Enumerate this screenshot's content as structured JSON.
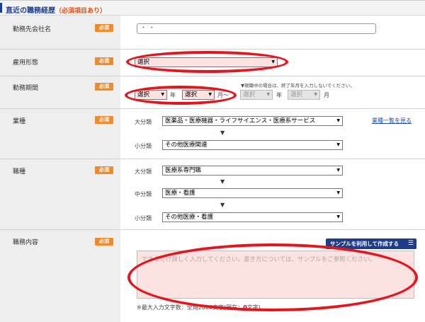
{
  "header": {
    "title": "直近の職務経歴",
    "required_note": "（必須項目あり）"
  },
  "required_badge": "必須",
  "fields": {
    "company": {
      "label": "勤務先会社名",
      "value": "・ ・"
    },
    "employment": {
      "label": "雇用形態",
      "select": "選択"
    },
    "period": {
      "label": "勤務期間",
      "note": "▼現職中の場合は、終了年月を入力しないでください。",
      "start_year": "選択",
      "year_unit": "年",
      "start_month": "選択",
      "month_from": "月〜",
      "end_year": "選択",
      "end_month": "選択",
      "month_unit": "月"
    },
    "industry": {
      "label": "業種",
      "major_label": "大分類",
      "major_value": "医薬品・医療機器・ライフサイエンス・医療系サービス",
      "minor_label": "小分類",
      "minor_value": "その他医療関連",
      "list_link": "業種一覧を見る"
    },
    "job": {
      "label": "職種",
      "major_label": "大分類",
      "major_value": "医療系専門職",
      "middle_label": "中分類",
      "middle_value": "医療・看護",
      "minor_label": "小分類",
      "minor_value": "その他医療・看護"
    },
    "duties": {
      "label": "職務内容",
      "sample_button": "サンプルを利用して作成する",
      "placeholder": "できるだけ詳しく入力してください。書き方については、サンプルをご参照ください。",
      "limit_prefix": "※最大入力文字数：全角2000文字(現在：",
      "count": "0",
      "limit_suffix": "文字)"
    }
  },
  "icons": {
    "dropdown": "▼",
    "list": "☰",
    "down_arrow": "▼"
  },
  "colors": {
    "accent": "#1f3f8e",
    "badge": "#f08a2a",
    "annotation": "#e8141c",
    "required_field": "#fde2e2"
  }
}
